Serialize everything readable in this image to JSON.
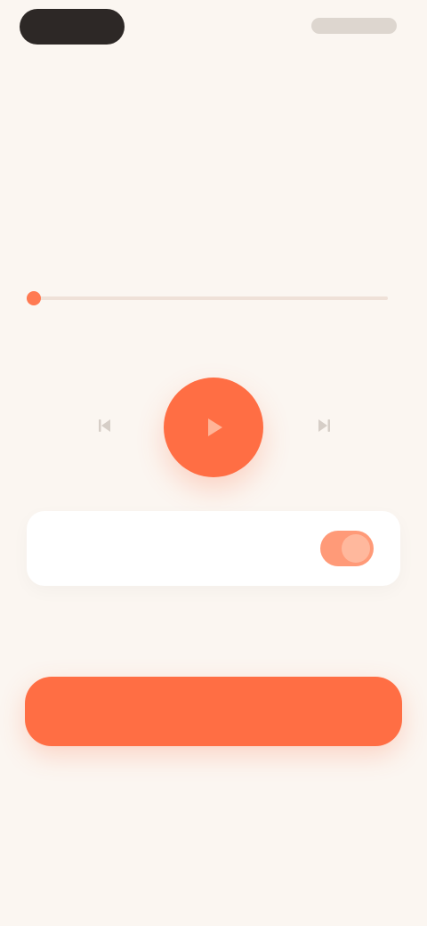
{
  "status_bar": {
    "left_pill": "",
    "right_indicators": ""
  },
  "nav": {
    "title": ""
  },
  "header": {
    "eyebrow": "",
    "headline": "",
    "subline": ""
  },
  "player": {
    "progress": 0.02,
    "elapsed": "",
    "remaining": "",
    "prev_icon": "skip-back-icon",
    "play_icon": "play-icon",
    "next_icon": "skip-forward-icon"
  },
  "option_card": {
    "label": "",
    "toggle_on": true
  },
  "secondary_link": {
    "label": ""
  },
  "primary_button": {
    "label": ""
  },
  "colors": {
    "background": "#fbf6f1",
    "accent": "#ff6e44",
    "accent_soft": "#ff9a78",
    "text_dark": "#2a2522",
    "text_muted": "#c7bfb8"
  }
}
